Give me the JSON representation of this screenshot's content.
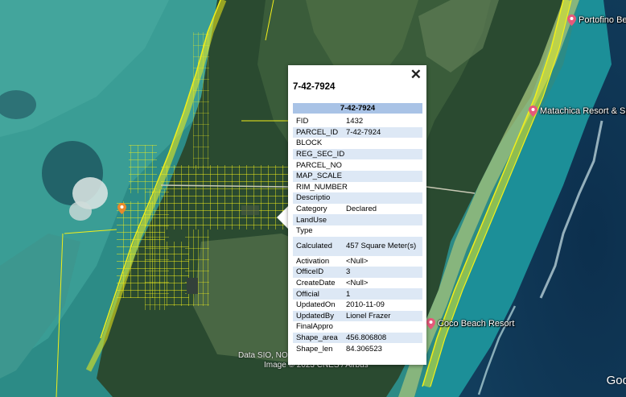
{
  "places": {
    "portofino": "Portofino Beac",
    "matachica": "Matachica Resort & Sp",
    "coco_beach": "Coco Beach Resort"
  },
  "attribution": {
    "line1": "Data SIO, NO",
    "line2": "Image © 2023 CNES / Airbus",
    "google": "Goo"
  },
  "popup": {
    "title": "7-42-7924",
    "close_label": "✕",
    "table_header": "7-42-7924",
    "rows": [
      {
        "key": "FID",
        "value": "1432"
      },
      {
        "key": "PARCEL_ID",
        "value": "7-42-7924"
      },
      {
        "key": "BLOCK",
        "value": ""
      },
      {
        "key": "REG_SEC_ID",
        "value": ""
      },
      {
        "key": "PARCEL_NO",
        "value": ""
      },
      {
        "key": "MAP_SCALE",
        "value": ""
      },
      {
        "key": "RIM_NUMBER",
        "value": ""
      },
      {
        "key": "Descriptio",
        "value": ""
      },
      {
        "key": "Category",
        "value": "Declared"
      },
      {
        "key": "LandUse",
        "value": ""
      },
      {
        "key": "Type",
        "value": ""
      },
      {
        "key": "Calculated",
        "value": "457 Square Meter(s)"
      },
      {
        "key": "Activation",
        "value": "<Null>"
      },
      {
        "key": "OfficeID",
        "value": "3"
      },
      {
        "key": "CreateDate",
        "value": "<Null>"
      },
      {
        "key": "Official",
        "value": "1"
      },
      {
        "key": "UpdatedOn",
        "value": "2010-11-09"
      },
      {
        "key": "UpdatedBy",
        "value": "Lionel Frazer"
      },
      {
        "key": "FinalAppro",
        "value": ""
      },
      {
        "key": "Shape_area",
        "value": "456.806808"
      },
      {
        "key": "Shape_len",
        "value": "84.306523"
      }
    ]
  },
  "colors": {
    "parcel_lines": "#f2ef1a",
    "header_band": "#a9c3e6",
    "alt_row": "#dde8f5",
    "place_pin": "#e5597a",
    "location_pin": "#e8892b"
  }
}
